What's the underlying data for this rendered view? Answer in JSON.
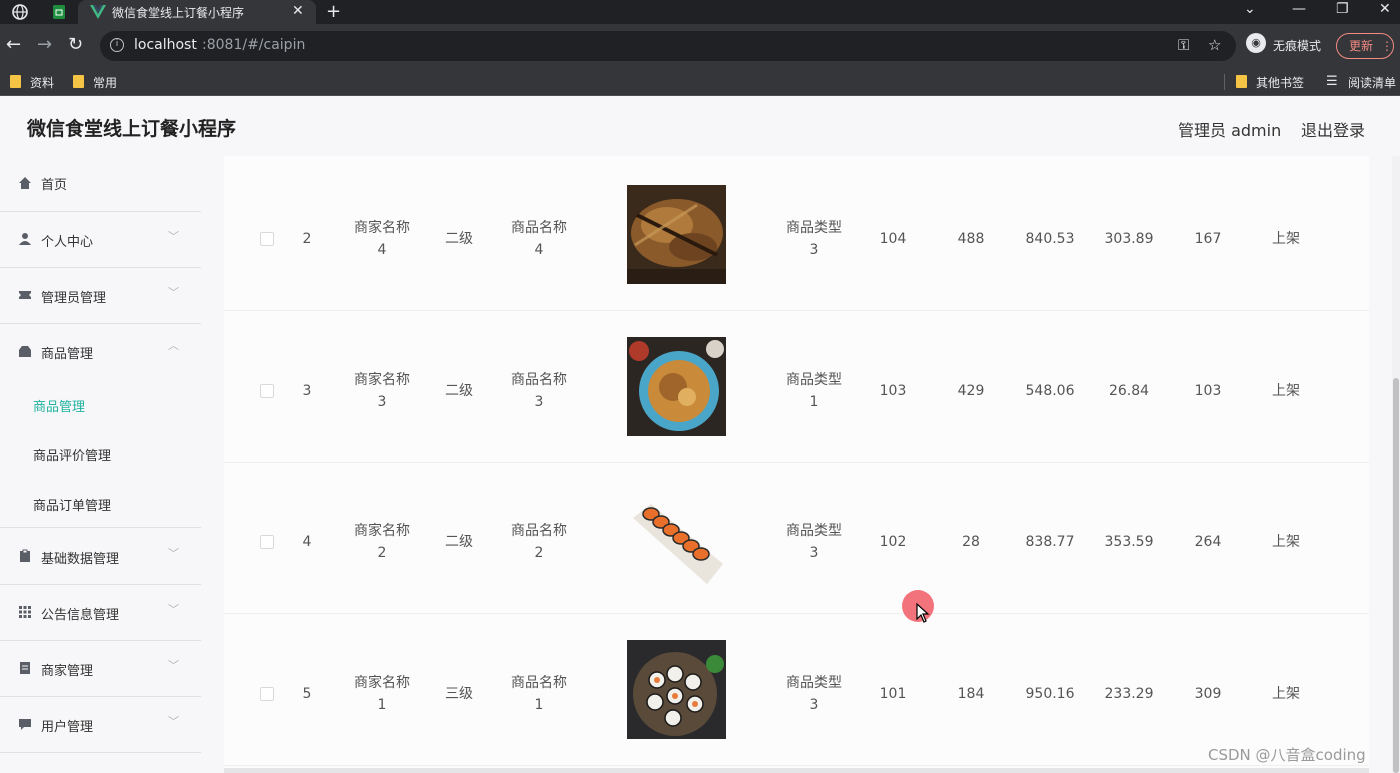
{
  "browser": {
    "tab_title": "微信食堂线上订餐小程序",
    "url_host": "localhost",
    "url_path": ":8081/#/caipin",
    "incognito_label": "无痕模式",
    "update_label": "更新",
    "bookmarks": [
      "资料",
      "常用"
    ],
    "other_bookmarks": "其他书签",
    "reading_list": "阅读清单"
  },
  "header": {
    "title": "微信食堂线上订餐小程序",
    "user": "管理员 admin",
    "logout": "退出登录"
  },
  "sidebar": {
    "items": [
      {
        "label": "首页",
        "icon": "home-icon"
      },
      {
        "label": "个人中心",
        "icon": "user-icon"
      },
      {
        "label": "管理员管理",
        "icon": "ticket-icon"
      },
      {
        "label": "商品管理",
        "icon": "shop-icon"
      },
      {
        "label": "基础数据管理",
        "icon": "clipboard-icon"
      },
      {
        "label": "公告信息管理",
        "icon": "grid-icon"
      },
      {
        "label": "商家管理",
        "icon": "document-icon"
      },
      {
        "label": "用户管理",
        "icon": "chat-icon"
      }
    ],
    "sub_items": [
      "商品管理",
      "商品评价管理",
      "商品订单管理"
    ]
  },
  "table": {
    "rows": [
      {
        "index": "2",
        "merchant": [
          "商家名称",
          "4"
        ],
        "level": "二级",
        "product": [
          "商品名称",
          "4"
        ],
        "type": [
          "商品类型",
          "3"
        ],
        "c1": "104",
        "c2": "488",
        "c3": "840.53",
        "c4": "303.89",
        "c5": "167",
        "status": "上架"
      },
      {
        "index": "3",
        "merchant": [
          "商家名称",
          "3"
        ],
        "level": "二级",
        "product": [
          "商品名称",
          "3"
        ],
        "type": [
          "商品类型",
          "1"
        ],
        "c1": "103",
        "c2": "429",
        "c3": "548.06",
        "c4": "26.84",
        "c5": "103",
        "status": "上架"
      },
      {
        "index": "4",
        "merchant": [
          "商家名称",
          "2"
        ],
        "level": "二级",
        "product": [
          "商品名称",
          "2"
        ],
        "type": [
          "商品类型",
          "3"
        ],
        "c1": "102",
        "c2": "28",
        "c3": "838.77",
        "c4": "353.59",
        "c5": "264",
        "status": "上架"
      },
      {
        "index": "5",
        "merchant": [
          "商家名称",
          "1"
        ],
        "level": "三级",
        "product": [
          "商品名称",
          "1"
        ],
        "type": [
          "商品类型",
          "3"
        ],
        "c1": "101",
        "c2": "184",
        "c3": "950.16",
        "c4": "233.29",
        "c5": "309",
        "status": "上架"
      }
    ]
  },
  "watermark": "CSDN @八音盒coding",
  "colors": {
    "accent": "#20b2a0",
    "chrome_dark": "#202124",
    "chrome": "#35363a"
  }
}
